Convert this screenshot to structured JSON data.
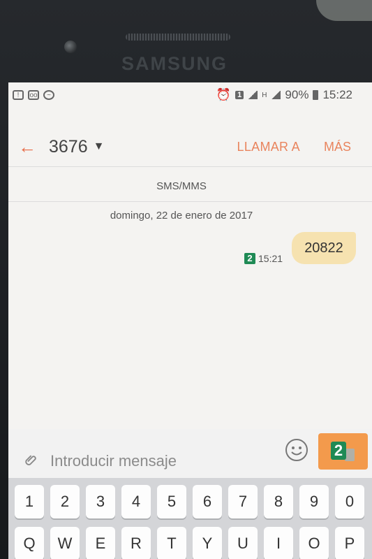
{
  "device": {
    "brand": "SAMSUNG"
  },
  "status_bar": {
    "sim": "1",
    "network": "H",
    "battery": "90%",
    "time": "15:22"
  },
  "app_bar": {
    "contact": "3676",
    "call_label": "LLAMAR A",
    "more_label": "MÁS"
  },
  "thread": {
    "type_label": "SMS/MMS",
    "date": "domingo, 22 de enero de 2017",
    "messages": [
      {
        "text": "20822",
        "time": "15:21",
        "sim": "2"
      }
    ]
  },
  "composer": {
    "placeholder": "Introducir mensaje",
    "send_sim": "2"
  },
  "keyboard": {
    "rows": [
      [
        "1",
        "2",
        "3",
        "4",
        "5",
        "6",
        "7",
        "8",
        "9",
        "0"
      ],
      [
        "Q",
        "W",
        "E",
        "R",
        "T",
        "Y",
        "U",
        "I",
        "O",
        "P"
      ]
    ]
  },
  "colors": {
    "accent": "#e9845d",
    "bubble": "#f6e2b0",
    "sim2": "#1f8a55",
    "send": "#f39a4c"
  }
}
